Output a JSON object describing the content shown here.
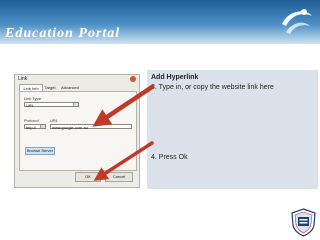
{
  "header": {
    "title": "Education Portal"
  },
  "dialog": {
    "title": "Link",
    "tabs": [
      "Link Info",
      "Target",
      "Advanced"
    ],
    "link_type_label": "Link Type",
    "link_type_value": "URL",
    "protocol_label": "Protocol",
    "protocol_value": "http://",
    "url_label": "URL",
    "url_value": "www.google.com.au",
    "browse_button": "Browse Server",
    "ok_button": "OK",
    "cancel_button": "Cancel"
  },
  "instructions": {
    "heading": "Add Hyperlink",
    "step3": "3. Type in, or copy the website link here",
    "step4": "4. Press Ok"
  },
  "colors": {
    "arrow": "#c0392b",
    "header": "#1f5f96",
    "panel": "#dbe2ec"
  }
}
